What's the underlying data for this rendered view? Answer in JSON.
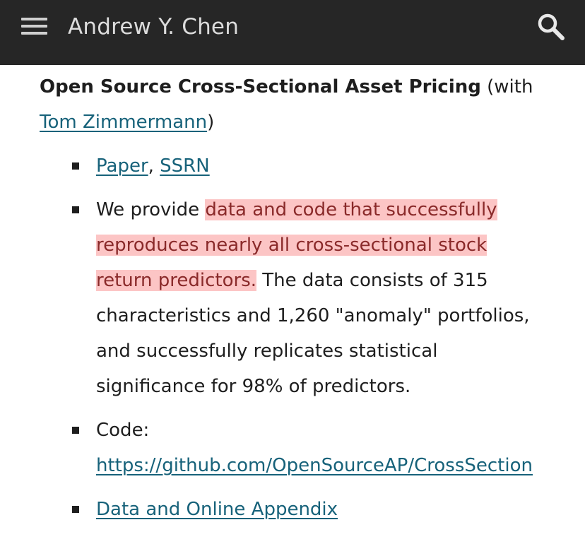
{
  "header": {
    "site_title": "Andrew Y. Chen",
    "menu_icon": "hamburger-menu-icon",
    "search_icon": "search-icon",
    "background": "#262626"
  },
  "content": {
    "heading": {
      "title": "Open Source Cross-Sectional Asset Pricing",
      "with_prefix": " (with ",
      "coauthor_link": "Tom Zimmermann",
      "suffix": ")"
    },
    "items": [
      {
        "paper_link": "Paper",
        "separator": ", ",
        "ssrn_link": "SSRN"
      },
      {
        "prefix": "We provide ",
        "highlight": "data and code that successfully reproduces nearly all cross-sectional stock return predictors.",
        "rest": "  The data consists of 315 characteristics and 1,260 \"anomaly\" portfolios, and successfully replicates statistical significance for 98% of predictors."
      },
      {
        "label": "Code: ",
        "code_link": "https://github.com/OpenSourceAP/CrossSection"
      },
      {
        "appendix_link": "Data and Online Appendix"
      }
    ],
    "link_color": "#17627a",
    "highlight_color": "#fcc5c5"
  }
}
